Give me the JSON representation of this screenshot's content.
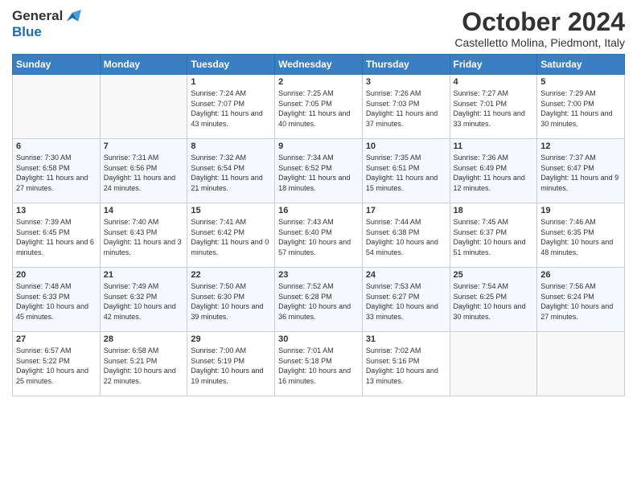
{
  "logo": {
    "line1": "General",
    "line2": "Blue"
  },
  "title": "October 2024",
  "location": "Castelletto Molina, Piedmont, Italy",
  "days_header": [
    "Sunday",
    "Monday",
    "Tuesday",
    "Wednesday",
    "Thursday",
    "Friday",
    "Saturday"
  ],
  "weeks": [
    [
      {
        "day": "",
        "info": ""
      },
      {
        "day": "",
        "info": ""
      },
      {
        "day": "1",
        "info": "Sunrise: 7:24 AM\nSunset: 7:07 PM\nDaylight: 11 hours and 43 minutes."
      },
      {
        "day": "2",
        "info": "Sunrise: 7:25 AM\nSunset: 7:05 PM\nDaylight: 11 hours and 40 minutes."
      },
      {
        "day": "3",
        "info": "Sunrise: 7:26 AM\nSunset: 7:03 PM\nDaylight: 11 hours and 37 minutes."
      },
      {
        "day": "4",
        "info": "Sunrise: 7:27 AM\nSunset: 7:01 PM\nDaylight: 11 hours and 33 minutes."
      },
      {
        "day": "5",
        "info": "Sunrise: 7:29 AM\nSunset: 7:00 PM\nDaylight: 11 hours and 30 minutes."
      }
    ],
    [
      {
        "day": "6",
        "info": "Sunrise: 7:30 AM\nSunset: 6:58 PM\nDaylight: 11 hours and 27 minutes."
      },
      {
        "day": "7",
        "info": "Sunrise: 7:31 AM\nSunset: 6:56 PM\nDaylight: 11 hours and 24 minutes."
      },
      {
        "day": "8",
        "info": "Sunrise: 7:32 AM\nSunset: 6:54 PM\nDaylight: 11 hours and 21 minutes."
      },
      {
        "day": "9",
        "info": "Sunrise: 7:34 AM\nSunset: 6:52 PM\nDaylight: 11 hours and 18 minutes."
      },
      {
        "day": "10",
        "info": "Sunrise: 7:35 AM\nSunset: 6:51 PM\nDaylight: 11 hours and 15 minutes."
      },
      {
        "day": "11",
        "info": "Sunrise: 7:36 AM\nSunset: 6:49 PM\nDaylight: 11 hours and 12 minutes."
      },
      {
        "day": "12",
        "info": "Sunrise: 7:37 AM\nSunset: 6:47 PM\nDaylight: 11 hours and 9 minutes."
      }
    ],
    [
      {
        "day": "13",
        "info": "Sunrise: 7:39 AM\nSunset: 6:45 PM\nDaylight: 11 hours and 6 minutes."
      },
      {
        "day": "14",
        "info": "Sunrise: 7:40 AM\nSunset: 6:43 PM\nDaylight: 11 hours and 3 minutes."
      },
      {
        "day": "15",
        "info": "Sunrise: 7:41 AM\nSunset: 6:42 PM\nDaylight: 11 hours and 0 minutes."
      },
      {
        "day": "16",
        "info": "Sunrise: 7:43 AM\nSunset: 6:40 PM\nDaylight: 10 hours and 57 minutes."
      },
      {
        "day": "17",
        "info": "Sunrise: 7:44 AM\nSunset: 6:38 PM\nDaylight: 10 hours and 54 minutes."
      },
      {
        "day": "18",
        "info": "Sunrise: 7:45 AM\nSunset: 6:37 PM\nDaylight: 10 hours and 51 minutes."
      },
      {
        "day": "19",
        "info": "Sunrise: 7:46 AM\nSunset: 6:35 PM\nDaylight: 10 hours and 48 minutes."
      }
    ],
    [
      {
        "day": "20",
        "info": "Sunrise: 7:48 AM\nSunset: 6:33 PM\nDaylight: 10 hours and 45 minutes."
      },
      {
        "day": "21",
        "info": "Sunrise: 7:49 AM\nSunset: 6:32 PM\nDaylight: 10 hours and 42 minutes."
      },
      {
        "day": "22",
        "info": "Sunrise: 7:50 AM\nSunset: 6:30 PM\nDaylight: 10 hours and 39 minutes."
      },
      {
        "day": "23",
        "info": "Sunrise: 7:52 AM\nSunset: 6:28 PM\nDaylight: 10 hours and 36 minutes."
      },
      {
        "day": "24",
        "info": "Sunrise: 7:53 AM\nSunset: 6:27 PM\nDaylight: 10 hours and 33 minutes."
      },
      {
        "day": "25",
        "info": "Sunrise: 7:54 AM\nSunset: 6:25 PM\nDaylight: 10 hours and 30 minutes."
      },
      {
        "day": "26",
        "info": "Sunrise: 7:56 AM\nSunset: 6:24 PM\nDaylight: 10 hours and 27 minutes."
      }
    ],
    [
      {
        "day": "27",
        "info": "Sunrise: 6:57 AM\nSunset: 5:22 PM\nDaylight: 10 hours and 25 minutes."
      },
      {
        "day": "28",
        "info": "Sunrise: 6:58 AM\nSunset: 5:21 PM\nDaylight: 10 hours and 22 minutes."
      },
      {
        "day": "29",
        "info": "Sunrise: 7:00 AM\nSunset: 5:19 PM\nDaylight: 10 hours and 19 minutes."
      },
      {
        "day": "30",
        "info": "Sunrise: 7:01 AM\nSunset: 5:18 PM\nDaylight: 10 hours and 16 minutes."
      },
      {
        "day": "31",
        "info": "Sunrise: 7:02 AM\nSunset: 5:16 PM\nDaylight: 10 hours and 13 minutes."
      },
      {
        "day": "",
        "info": ""
      },
      {
        "day": "",
        "info": ""
      }
    ]
  ]
}
